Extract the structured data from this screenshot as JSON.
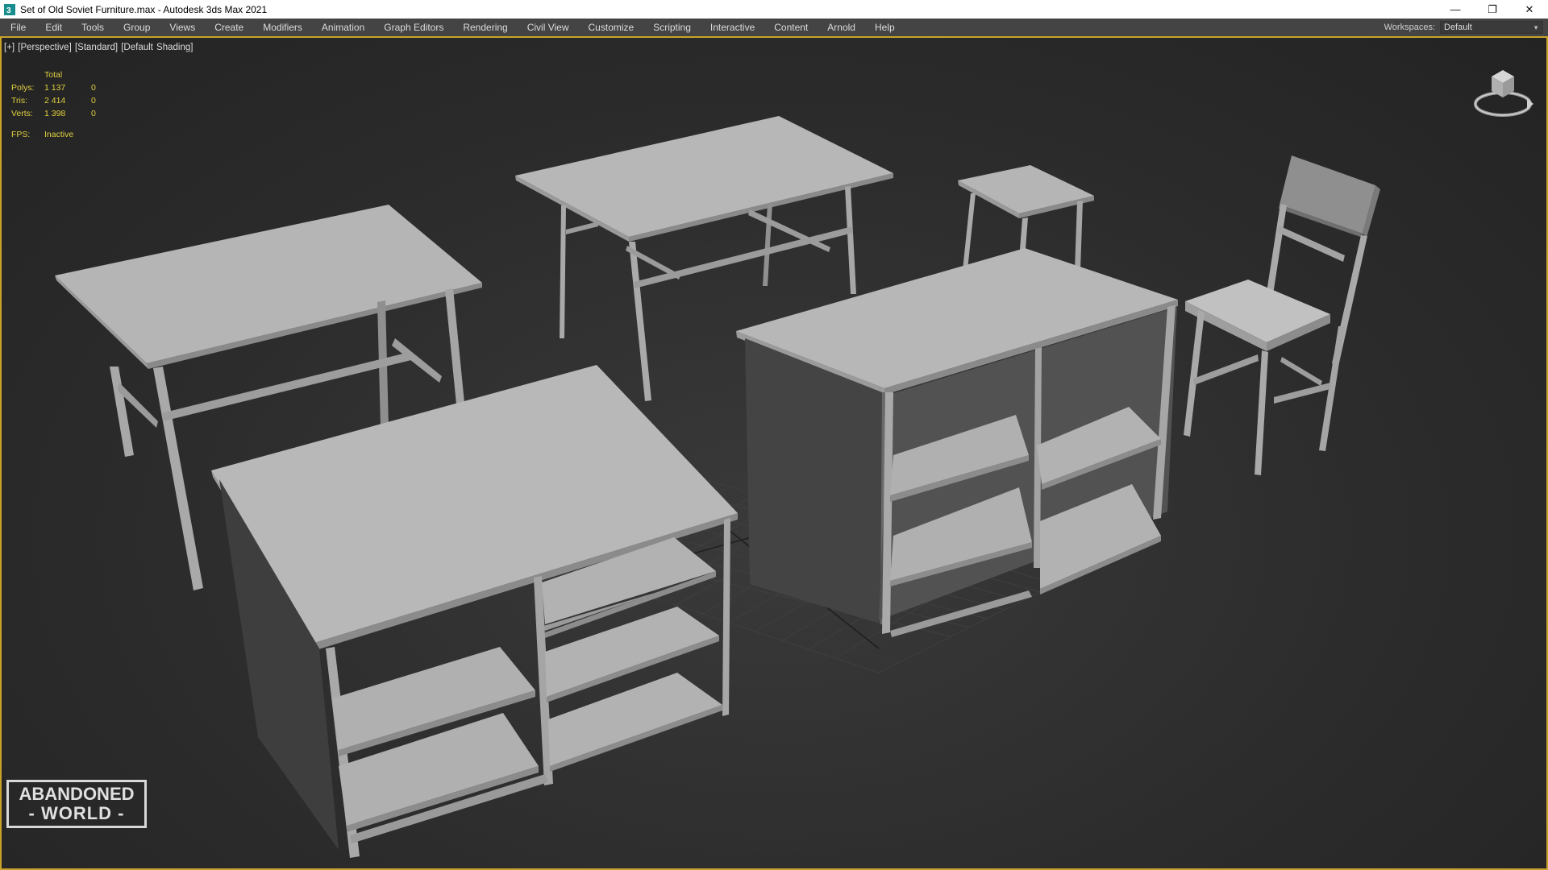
{
  "window": {
    "title": "Set of Old Soviet Furniture.max - Autodesk 3ds Max 2021",
    "controls": {
      "minimize": "—",
      "restore": "❐",
      "close": "✕"
    }
  },
  "menu": {
    "items": [
      "File",
      "Edit",
      "Tools",
      "Group",
      "Views",
      "Create",
      "Modifiers",
      "Animation",
      "Graph Editors",
      "Rendering",
      "Civil View",
      "Customize",
      "Scripting",
      "Interactive",
      "Content",
      "Arnold",
      "Help"
    ],
    "workspaces_label": "Workspaces:",
    "workspaces_value": "Default"
  },
  "viewport": {
    "label": "[+] [Perspective] [Standard] [Default Shading]",
    "stats": {
      "header": "Total",
      "polys_label": "Polys:",
      "polys_total": "1 137",
      "polys_sel": "0",
      "tris_label": "Tris:",
      "tris_total": "2 414",
      "tris_sel": "0",
      "verts_label": "Verts:",
      "verts_total": "1 398",
      "verts_sel": "0",
      "fps_label": "FPS:",
      "fps_value": "Inactive"
    },
    "viewcube_icon": "viewcube-icon"
  },
  "watermark": {
    "line1": "ABANDONED",
    "line2": "- WORLD -"
  },
  "colors": {
    "stats_text": "#e0cf3f",
    "viewport_border": "#c8a32b",
    "menubar_bg": "#444444",
    "model_top": "#b4b4b4",
    "model_side": "#7c7c7c",
    "model_dark": "#4e4e4e"
  }
}
